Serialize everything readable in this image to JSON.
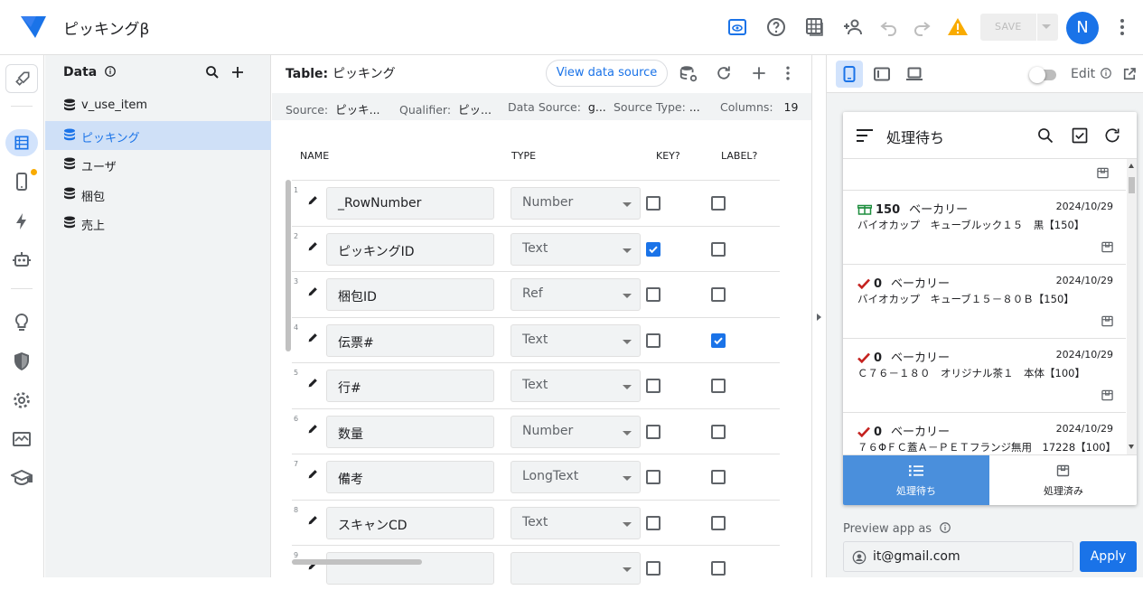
{
  "app": {
    "title": "ピッキングβ",
    "save_label": "SAVE",
    "avatar_letter": "N",
    "accent": "#1a73e8",
    "warning_color": "#f9ab00"
  },
  "data_panel": {
    "title": "Data",
    "tables": [
      {
        "label": "v_use_item",
        "active": false
      },
      {
        "label": "ピッキング",
        "active": true
      },
      {
        "label": "ユーザ",
        "active": false
      },
      {
        "label": "梱包",
        "active": false
      },
      {
        "label": "売上",
        "active": false
      }
    ]
  },
  "table": {
    "title_prefix": "Table:",
    "title_name": "ピッキング",
    "view_source_label": "View data source",
    "info": {
      "source_label": "Source:",
      "source_value": "ピッキ...",
      "qualifier_label": "Qualifier:",
      "qualifier_value": "ピッ...",
      "datasource_label": "Data Source:",
      "datasource_value": "g...",
      "sourcetype_label": "Source Type:",
      "sourcetype_value": "...",
      "columns_label": "Columns:",
      "columns_value": "19"
    },
    "headers": {
      "name": "NAME",
      "type": "TYPE",
      "key": "KEY?",
      "label": "LABEL?"
    },
    "rows": [
      {
        "num": "1",
        "name": "_RowNumber",
        "type": "Number",
        "key": false,
        "label": false
      },
      {
        "num": "2",
        "name": "ピッキングID",
        "type": "Text",
        "key": true,
        "label": false
      },
      {
        "num": "3",
        "name": "梱包ID",
        "type": "Ref",
        "key": false,
        "label": false
      },
      {
        "num": "4",
        "name": "伝票#",
        "type": "Text",
        "key": false,
        "label": true
      },
      {
        "num": "5",
        "name": "行#",
        "type": "Text",
        "key": false,
        "label": false
      },
      {
        "num": "6",
        "name": "数量",
        "type": "Number",
        "key": false,
        "label": false
      },
      {
        "num": "7",
        "name": "備考",
        "type": "LongText",
        "key": false,
        "label": false
      },
      {
        "num": "8",
        "name": "スキャンCD",
        "type": "Text",
        "key": false,
        "label": false
      },
      {
        "num": "9",
        "name": "",
        "type": "",
        "key": false,
        "label": false
      }
    ]
  },
  "preview": {
    "edit_label": "Edit",
    "view_title": "処理待ち",
    "cards": [
      {
        "qty": "150",
        "category": "ベーカリー",
        "date": "2024/10/29",
        "desc": "バイオカップ　キューブルック１５　黒【150】",
        "status": "box"
      },
      {
        "qty": "0",
        "category": "ベーカリー",
        "date": "2024/10/29",
        "desc": "バイオカップ　キューブ１５－８０Ｂ【150】",
        "status": "check"
      },
      {
        "qty": "0",
        "category": "ベーカリー",
        "date": "2024/10/29",
        "desc": "Ｃ７６－１８０　オリジナル茶１　本体【100】",
        "status": "check"
      },
      {
        "qty": "0",
        "category": "ベーカリー",
        "date": "2024/10/29",
        "desc": "７６ΦＦＣ蓋Ａ－ＰＥＴフランジ無用　17228【100】",
        "status": "check"
      }
    ],
    "tabs": [
      {
        "label": "処理待ち",
        "active": true
      },
      {
        "label": "処理済み",
        "active": false
      }
    ],
    "preview_as_label": "Preview app as",
    "user_email": "it@gmail.com",
    "apply_label": "Apply"
  }
}
